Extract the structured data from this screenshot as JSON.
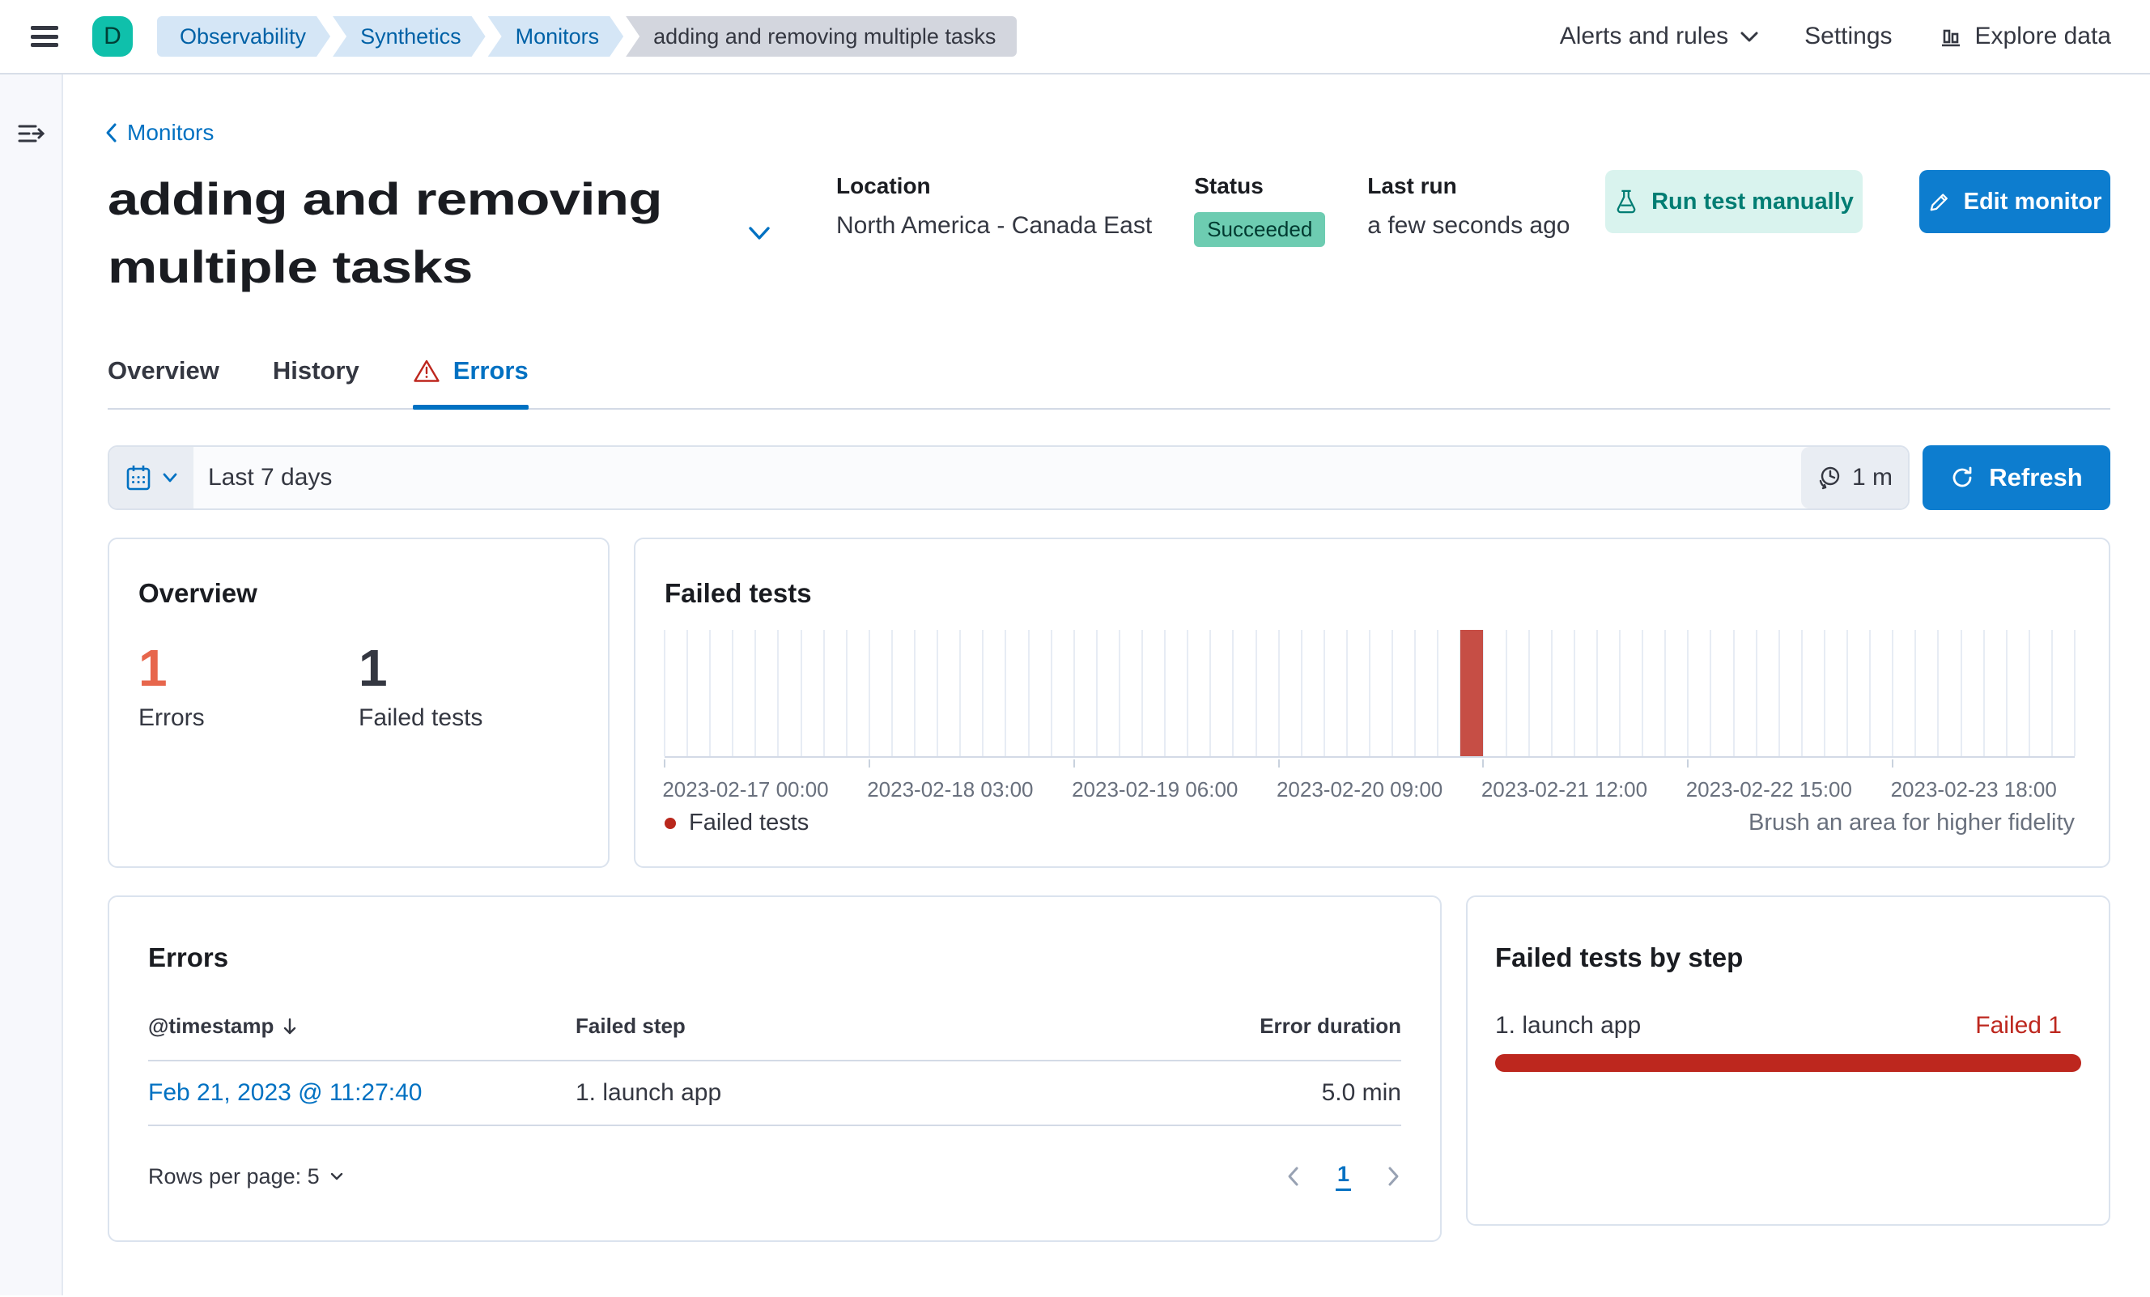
{
  "header": {
    "avatar_initial": "D",
    "breadcrumbs": [
      "Observability",
      "Synthetics",
      "Monitors",
      "adding and removing multiple tasks"
    ],
    "nav": {
      "alerts": "Alerts and rules",
      "settings": "Settings",
      "explore": "Explore data"
    }
  },
  "page": {
    "back_link": "Monitors",
    "title": "adding and removing multiple tasks",
    "meta": {
      "location_label": "Location",
      "location_value": "North America - Canada East",
      "status_label": "Status",
      "status_value": "Succeeded",
      "last_run_label": "Last run",
      "last_run_value": "a few seconds ago"
    },
    "actions": {
      "run_test": "Run test manually",
      "edit": "Edit monitor"
    },
    "tabs": {
      "overview": "Overview",
      "history": "History",
      "errors": "Errors"
    }
  },
  "toolbar": {
    "range": "Last 7 days",
    "interval": "1 m",
    "refresh": "Refresh"
  },
  "overview_panel": {
    "title": "Overview",
    "stats": [
      {
        "value": "1",
        "label": "Errors",
        "color": "#e7664c"
      },
      {
        "value": "1",
        "label": "Failed tests",
        "color": "#343741"
      }
    ]
  },
  "failed_tests_panel": {
    "title": "Failed tests",
    "legend": "Failed tests",
    "hint": "Brush an area for higher fidelity"
  },
  "chart_data": {
    "type": "bar",
    "title": "Failed tests",
    "x_start": "2023-02-17T00:00",
    "bin_hours": 3,
    "bins": 62,
    "tick_every_bins": 9,
    "tick_labels": [
      "2023-02-17 00:00",
      "2023-02-18 03:00",
      "2023-02-19 06:00",
      "2023-02-20 09:00",
      "2023-02-21 12:00",
      "2023-02-22 15:00",
      "2023-02-23 18:00"
    ],
    "ylim": [
      0,
      1
    ],
    "series": [
      {
        "name": "Failed tests",
        "color": "#b9271c",
        "points": [
          {
            "x": "2023-02-21T09:00",
            "y": 1
          }
        ]
      }
    ]
  },
  "errors_panel": {
    "title": "Errors",
    "columns": {
      "timestamp": "@timestamp",
      "failed_step": "Failed step",
      "error_duration": "Error duration"
    },
    "rows": [
      {
        "timestamp": "Feb 21, 2023 @ 11:27:40",
        "failed_step": "1. launch app",
        "error_duration": "5.0 min"
      }
    ],
    "rows_per_page": "Rows per page: 5",
    "page": "1"
  },
  "steps_panel": {
    "title": "Failed tests by step",
    "steps": [
      {
        "name": "1. launch app",
        "status": "Failed 1",
        "value": 1,
        "max": 1
      }
    ]
  }
}
